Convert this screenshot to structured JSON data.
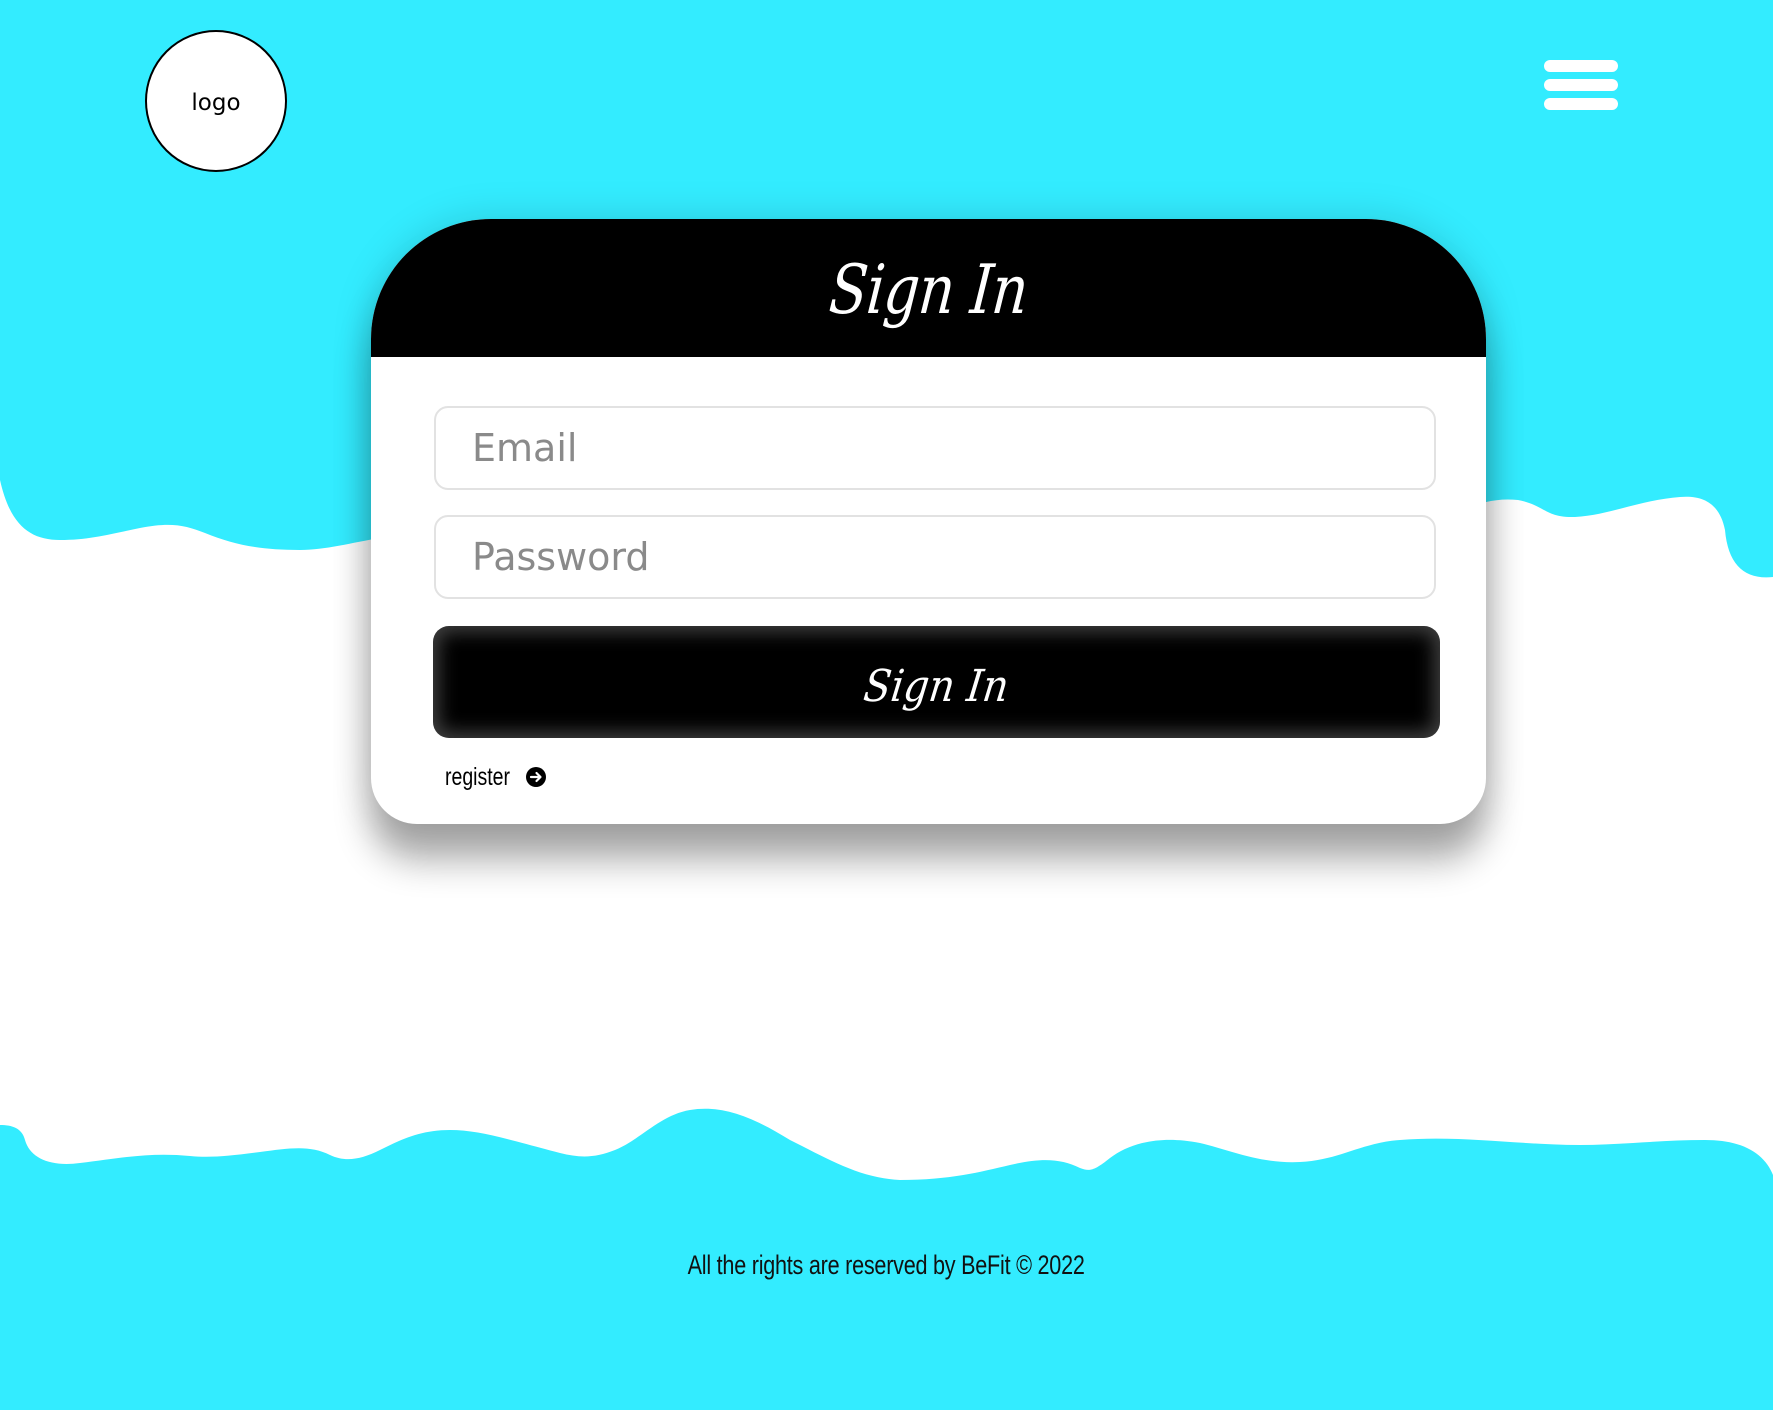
{
  "colors": {
    "wave": "#33ecff",
    "header_bg": "#000000",
    "card_bg": "#ffffff",
    "button_bg": "#000000"
  },
  "header": {
    "logo_text": "logo",
    "menu_icon": "hamburger-menu-icon"
  },
  "signin_card": {
    "title": "Sign In",
    "email_placeholder": "Email",
    "email_value": "",
    "password_placeholder": "Password",
    "password_value": "",
    "submit_label": "Sign In",
    "register_label": "register",
    "register_icon": "arrow-right-circle-icon"
  },
  "footer": {
    "copyright": "All the rights are reserved by BeFit © 2022"
  }
}
